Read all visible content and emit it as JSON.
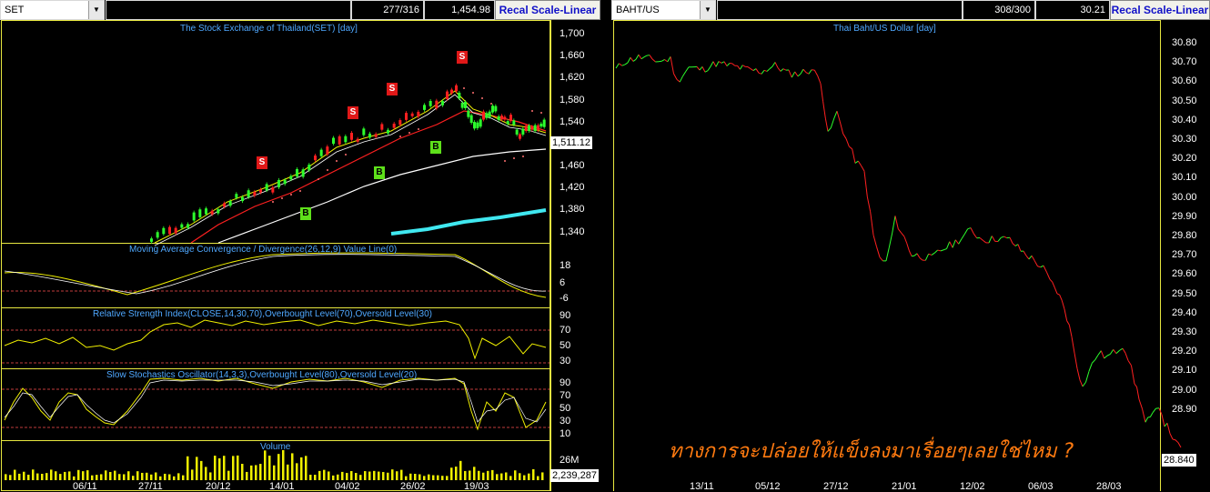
{
  "left": {
    "toolbar": {
      "symbol": "SET",
      "count": "277/316",
      "last_value": "1,454.98",
      "scale_button": "Recal Scale-Linear"
    },
    "price_panel": {
      "title": "The Stock Exchange of Thailand(SET) [day]",
      "y_ticks": [
        "1,700",
        "1,660",
        "1,620",
        "1,580",
        "1,540",
        "1,500",
        "1,460",
        "1,420",
        "1,380",
        "1,340"
      ],
      "current_badge": "1,511.12"
    },
    "macd_panel": {
      "title": "Moving Average Convergence / Divergence(26,12,9) Value Line(0)",
      "y_ticks": [
        "18",
        "6",
        "-6"
      ]
    },
    "rsi_panel": {
      "title": "Relative Strength Index(CLOSE,14,30,70),Overbought Level(70),Oversold Level(30)",
      "y_ticks": [
        "90",
        "70",
        "50",
        "30"
      ]
    },
    "stoch_panel": {
      "title": "Slow Stochastics Oscillator(14,3,3),Overbought Level(80),Oversold Level(20)",
      "y_ticks": [
        "90",
        "70",
        "50",
        "30",
        "10"
      ]
    },
    "volume_panel": {
      "title": "Volume",
      "y_tick": "26M",
      "current_badge": "2,239,287"
    },
    "x_dates": [
      "06/11",
      "27/11",
      "20/12",
      "14/01",
      "04/02",
      "26/02",
      "19/03"
    ],
    "signals": [
      "S",
      "S",
      "S",
      "S",
      "B",
      "B",
      "B"
    ]
  },
  "right": {
    "toolbar": {
      "symbol": "BAHT/US",
      "count": "308/300",
      "last_value": "30.21",
      "scale_button": "Recal Scale-Linear"
    },
    "title": "Thai Baht/US Dollar [day]",
    "y_ticks": [
      "30.80",
      "30.70",
      "30.60",
      "30.50",
      "30.40",
      "30.30",
      "30.20",
      "30.10",
      "30.00",
      "29.90",
      "29.80",
      "29.70",
      "29.60",
      "29.50",
      "29.40",
      "29.30",
      "29.20",
      "29.10",
      "29.00",
      "28.90"
    ],
    "current_badge": "28.840",
    "x_dates": [
      "13/11",
      "05/12",
      "27/12",
      "21/01",
      "12/02",
      "06/03",
      "28/03"
    ],
    "annotation": "ทางการจะปล่อยให้แข็งลงมาเรื่อยๆเลยใช่ไหม ?"
  },
  "colors": {
    "up": "#2cff2c",
    "down": "#ff2020",
    "frame": "#e8e840",
    "cyan": "#40e8f0",
    "volume": "#f0f000",
    "title": "#4fa8ff"
  },
  "chart_data": [
    {
      "type": "line",
      "title": "Thai Baht/US Dollar [day]",
      "ylim": [
        28.84,
        30.85
      ],
      "x": [
        "13/11",
        "05/12",
        "27/12",
        "21/01",
        "12/02",
        "06/03",
        "28/03"
      ],
      "series": [
        {
          "values": [
            30.71,
            30.73,
            30.62,
            29.77,
            29.83,
            29.74,
            29.31
          ]
        }
      ]
    },
    {
      "type": "bar",
      "title": "Volume",
      "categories": [
        "06/11",
        "27/11",
        "20/12",
        "14/01",
        "04/02",
        "26/02",
        "19/03"
      ],
      "series": [
        {
          "values": [
            6,
            8,
            12,
            20,
            13,
            14,
            10
          ]
        }
      ]
    }
  ]
}
